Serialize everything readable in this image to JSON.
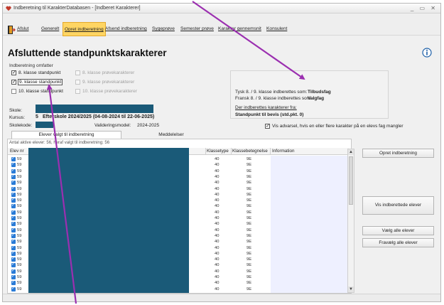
{
  "window": {
    "title": "Indberetning til KarakterDatabasen - [Indberet Karakterer]",
    "controls": "_ ▭ ✕"
  },
  "toolbar": {
    "items": [
      {
        "label": "Afslut"
      },
      {
        "label": "Generelt"
      },
      {
        "label": "Opret indberetning"
      },
      {
        "label": "Afsend indberetning"
      },
      {
        "label": "Sygeprøve"
      },
      {
        "label": "Semester prøve"
      },
      {
        "label": "Karakter gennemsnit"
      },
      {
        "label": "Konsulent"
      }
    ],
    "active_index": 2
  },
  "header": {
    "title": "Afsluttende standpunktskarakterer",
    "info_icon": "info-icon"
  },
  "indberetning_group": {
    "title": "Indberetning omfatter",
    "standpunkt": [
      {
        "label": "8. klasse standpunkt",
        "checked": true,
        "boxed": false
      },
      {
        "label": "9. klasse standpunkt",
        "checked": true,
        "boxed": true
      },
      {
        "label": "10. klasse standpunkt",
        "checked": false,
        "boxed": false
      }
    ],
    "proeve": [
      {
        "label": "8. klasse prøvekarakterer",
        "checked": false
      },
      {
        "label": "9. klasse prøvekarakterer",
        "checked": false
      },
      {
        "label": "10. klasse prøvekarakterer",
        "checked": false
      }
    ]
  },
  "school": {
    "skole_label": "Skole:",
    "kursus_label": "Kursus:",
    "kursus_value": "Efterskole 2024/2025  (04-08-2024 til 22-06-2025)",
    "kursus_prefix": "5",
    "skolekode_label": "Skolekode:",
    "valideringsmodel_label": "Valideringsmodel:",
    "valideringsmodel_value": "2024-2025"
  },
  "info_panel": {
    "line1_label": "Tysk 8. / 9. klasse indberettes som:",
    "line1_value": "Tilbudsfag",
    "line2_label": "Fransk 8. / 9. klasse indberettes som:",
    "line2_value": "Valgfag",
    "link": "Der indberettes karakterer fra:",
    "source": "Standpunkt til bevis (std.pkt. 0)"
  },
  "warning_checkbox": {
    "label": "Vis advarsel, hvis en eller flere karakter på en elevs fag mangler",
    "checked": true
  },
  "tabs": [
    {
      "label": "Elever valgt til indberetning"
    },
    {
      "label": "Meddelelser"
    }
  ],
  "grid": {
    "caption": "Antal aktive elever: 56, heraf valgt til indberetning: 56",
    "columns": [
      "Elev nr",
      "Klassetype",
      "Klassebetegnelse",
      "Information"
    ],
    "rows": [
      {
        "nr": "59",
        "klassetype": "40",
        "betegnelse": "9E"
      },
      {
        "nr": "59",
        "klassetype": "40",
        "betegnelse": "9E"
      },
      {
        "nr": "59",
        "klassetype": "40",
        "betegnelse": "9E"
      },
      {
        "nr": "59",
        "klassetype": "40",
        "betegnelse": "9E"
      },
      {
        "nr": "59",
        "klassetype": "40",
        "betegnelse": "9E"
      },
      {
        "nr": "59",
        "klassetype": "40",
        "betegnelse": "9E"
      },
      {
        "nr": "59",
        "klassetype": "40",
        "betegnelse": "9E"
      },
      {
        "nr": "59",
        "klassetype": "40",
        "betegnelse": "9E"
      },
      {
        "nr": "59",
        "klassetype": "40",
        "betegnelse": "9E"
      },
      {
        "nr": "59",
        "klassetype": "40",
        "betegnelse": "9E"
      },
      {
        "nr": "59",
        "klassetype": "40",
        "betegnelse": "9E"
      },
      {
        "nr": "59",
        "klassetype": "40",
        "betegnelse": "9E"
      },
      {
        "nr": "59",
        "klassetype": "40",
        "betegnelse": "9E"
      },
      {
        "nr": "59",
        "klassetype": "40",
        "betegnelse": "9E"
      },
      {
        "nr": "59",
        "klassetype": "40",
        "betegnelse": "9E"
      },
      {
        "nr": "59",
        "klassetype": "40",
        "betegnelse": "9E"
      },
      {
        "nr": "59",
        "klassetype": "40",
        "betegnelse": "9E"
      },
      {
        "nr": "59",
        "klassetype": "40",
        "betegnelse": "9E"
      },
      {
        "nr": "59",
        "klassetype": "40",
        "betegnelse": "9E"
      },
      {
        "nr": "59",
        "klassetype": "40",
        "betegnelse": "9E"
      },
      {
        "nr": "59",
        "klassetype": "40",
        "betegnelse": "9E"
      },
      {
        "nr": "59",
        "klassetype": "40",
        "betegnelse": "9E"
      },
      {
        "nr": "59",
        "klassetype": "40",
        "betegnelse": "9E"
      }
    ]
  },
  "side_buttons": [
    {
      "label": "Opret indberetning"
    },
    {
      "label": "Vis indberettede elever"
    },
    {
      "label": "Vælg alle elever"
    },
    {
      "label": "Fravælg alle elever"
    }
  ],
  "colors": {
    "active_tool": "#ffd563",
    "redaction": "#1a5a78",
    "annotation_arrow": "#9b2fb0",
    "row_checkbox": "#2a7bd6",
    "info_column": "#eef0ff"
  }
}
